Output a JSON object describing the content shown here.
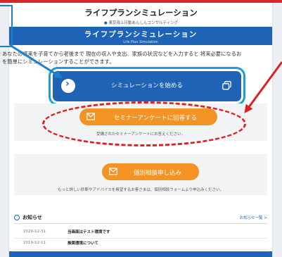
{
  "header": {
    "title": "ライフプランシミュレーション",
    "company": "東京海上日動あんしんコンサルティング"
  },
  "banner": {
    "title": "ライフプランシミュレーション",
    "subtitle_en": "Life Plan Simulation"
  },
  "intro": {
    "line1": "あなたの将来を子育てから老後まで 現在の収入や支出、家族の状況などを入力すると 将来必要になるお",
    "line2": "を簡単にシミュレーションすることができます。"
  },
  "actions": {
    "start_simulation": "シミュレーションを始める",
    "survey_button": "セミナーアンケートに回答する",
    "survey_note": "受講されたセミナーアンケートにお答えください。",
    "consult_button": "個別相談申し込み",
    "consult_note": "もっと詳しい診断やアドバイスを希望するお客さまは、個別相談フォームより申込みください。"
  },
  "news": {
    "title": "お知らせ",
    "view_all": "お知らせ一覧 >",
    "items": [
      {
        "date": "2029-12-31",
        "text": "当画面はテスト環境です"
      },
      {
        "date": "2019-12-11",
        "text": "推奨環境について"
      }
    ]
  },
  "colors": {
    "primary_blue": "#1f63b6",
    "orange": "#f39324",
    "annotation_red": "#e02020",
    "annotation_blue": "#1e9bd8"
  },
  "icons": {
    "start_button": "chevron-right-icon",
    "start_button_right": "copy-icon",
    "survey_button": "envelope-icon",
    "consult_button": "envelope-icon",
    "news": "circle-icon"
  }
}
